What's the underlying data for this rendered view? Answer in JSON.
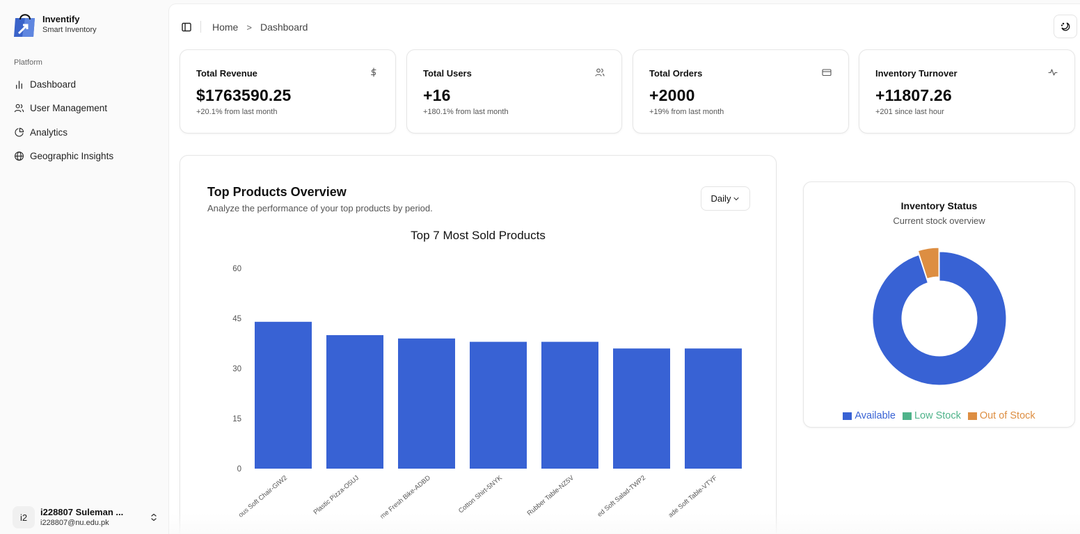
{
  "app": {
    "name": "Inventify",
    "subtitle": "Smart Inventory"
  },
  "sidebar": {
    "section_label": "Platform",
    "items": [
      {
        "label": "Dashboard",
        "icon": "bar-chart-icon"
      },
      {
        "label": "User Management",
        "icon": "users-icon"
      },
      {
        "label": "Analytics",
        "icon": "pie-chart-icon"
      },
      {
        "label": "Geographic Insights",
        "icon": "globe-icon"
      }
    ],
    "user": {
      "initials": "i2",
      "name": "i228807 Suleman ...",
      "email": "i228807@nu.edu.pk"
    }
  },
  "breadcrumb": {
    "home": "Home",
    "current": "Dashboard"
  },
  "stats": [
    {
      "title": "Total Revenue",
      "value": "$1763590.25",
      "sub": "+20.1% from last month",
      "icon": "dollar-icon"
    },
    {
      "title": "Total Users",
      "value": "+16",
      "sub": "+180.1% from last month",
      "icon": "users-icon"
    },
    {
      "title": "Total Orders",
      "value": "+2000",
      "sub": "+19% from last month",
      "icon": "credit-card-icon"
    },
    {
      "title": "Inventory Turnover",
      "value": "+11807.26",
      "sub": "+201 since last hour",
      "icon": "activity-icon"
    }
  ],
  "top_products": {
    "heading": "Top Products Overview",
    "description": "Analyze the performance of your top products by period.",
    "period": "Daily"
  },
  "inventory": {
    "title": "Inventory Status",
    "subtitle": "Current stock overview"
  },
  "chart_data": [
    {
      "type": "bar",
      "title": "Top 7 Most Sold Products",
      "categories": [
        "ous Soft Chair-GIW2",
        "Plastic Pizza-O5UJ",
        "me Fresh Bike-ADBD",
        "Cotton Shirt-5NYK",
        "Rubber Table-NZ5V",
        "ed Soft Salad-TWP2",
        "ade Soft Table-VTYF"
      ],
      "values": [
        44,
        40,
        39,
        38,
        38,
        36,
        36
      ],
      "yticks": [
        0,
        15,
        30,
        45,
        60
      ],
      "ylim": [
        0,
        60
      ],
      "color": "#3862d4",
      "grid": false
    },
    {
      "type": "pie",
      "donut": true,
      "labels": [
        "Available",
        "Low Stock",
        "Out of Stock"
      ],
      "values": [
        95,
        0,
        5
      ],
      "colors": [
        "#3862d4",
        "#4fb38a",
        "#dd8e42"
      ],
      "legend": "bottom"
    }
  ]
}
